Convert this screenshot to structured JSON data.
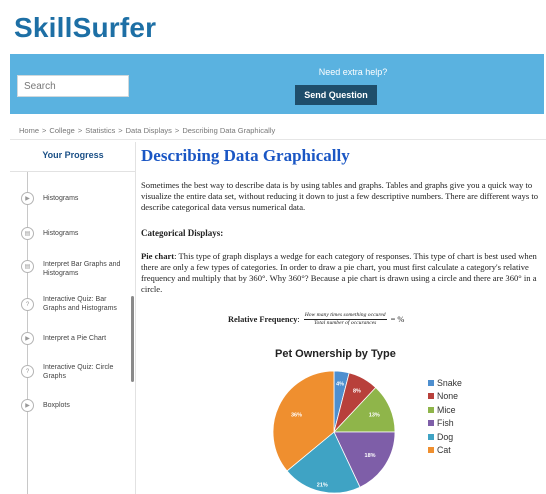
{
  "site": {
    "logo": "SkillSurfer"
  },
  "banner": {
    "search_placeholder": "Search",
    "help_text": "Need extra help?",
    "send_label": "Send Question"
  },
  "breadcrumb": [
    "Home",
    "College",
    "Statistics",
    "Data Displays",
    "Describing Data Graphically"
  ],
  "breadcrumb_sep": ">",
  "sidebar": {
    "title": "Your Progress",
    "items": [
      {
        "label": "Histograms",
        "icon": "play-icon"
      },
      {
        "label": "Histograms",
        "icon": "document-icon"
      },
      {
        "label": "Interpret Bar Graphs and Histograms",
        "icon": "document-icon"
      },
      {
        "label": "Interactive Quiz: Bar Graphs and Histograms",
        "icon": "quiz-icon"
      },
      {
        "label": "Interpret a Pie Chart",
        "icon": "play-icon"
      },
      {
        "label": "Interactive Quiz: Circle Graphs",
        "icon": "quiz-icon"
      },
      {
        "label": "Boxplots",
        "icon": "play-icon"
      }
    ]
  },
  "article": {
    "title": "Describing Data Graphically",
    "intro": "Sometimes the best way to describe data is by using tables and graphs. Tables and graphs give you a quick way to visualize the entire data set, without reducing it down to just a few descriptive numbers. There are different ways to describe categorical data versus numerical data.",
    "subhead": "Categorical Displays:",
    "pie_term": "Pie chart",
    "pie_text": ": This type of graph displays a wedge for each category of responses. This type of chart is best used when there are only a few types of categories. In order to draw a pie chart, you must first calculate a category's relative frequency and multiply that by 360°. Why 360°? Because a pie chart is drawn using a circle and there are 360° in a circle.",
    "formula_label": "Relative Frequency",
    "formula_colon": ":",
    "formula_numerator": "How many times something occured",
    "formula_denominator": "Total number of occurances",
    "formula_suffix": "= %"
  },
  "chart_data": {
    "type": "pie",
    "title": "Pet Ownership by Type",
    "categories": [
      "Snake",
      "None",
      "Mice",
      "Fish",
      "Dog",
      "Cat"
    ],
    "values": [
      4,
      8,
      13,
      18,
      21,
      36
    ],
    "labels": [
      "4%",
      "8%",
      "13%",
      "18%",
      "21%",
      "36%"
    ],
    "colors": [
      "#4e8fcf",
      "#b8403b",
      "#8fb54a",
      "#7e5ea8",
      "#3fa3c4",
      "#ef8f2f"
    ],
    "legend_position": "right"
  }
}
